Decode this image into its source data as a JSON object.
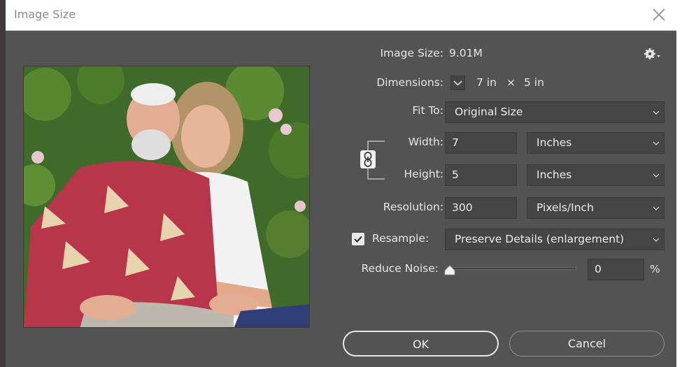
{
  "window": {
    "title": "Image Size"
  },
  "info": {
    "image_size_label": "Image Size:",
    "image_size_value": "9.01M",
    "dimensions_label": "Dimensions:",
    "dimensions_width": "7 in",
    "dimensions_times": "×",
    "dimensions_height": "5 in"
  },
  "fit_to": {
    "label": "Fit To:",
    "value": "Original Size"
  },
  "width": {
    "label": "Width:",
    "value": "7",
    "unit": "Inches"
  },
  "height": {
    "label": "Height:",
    "value": "5",
    "unit": "Inches"
  },
  "resolution": {
    "label": "Resolution:",
    "value": "300",
    "unit": "Pixels/Inch"
  },
  "resample": {
    "label": "Resample:",
    "checked": true,
    "method": "Preserve Details (enlargement)"
  },
  "reduce_noise": {
    "label": "Reduce Noise:",
    "value": "0",
    "unit": "%",
    "slider_fraction": 0
  },
  "buttons": {
    "ok": "OK",
    "cancel": "Cancel"
  },
  "colors": {
    "dialog_bg": "#535353",
    "field_bg": "#454545",
    "text": "#e6e6e6"
  }
}
